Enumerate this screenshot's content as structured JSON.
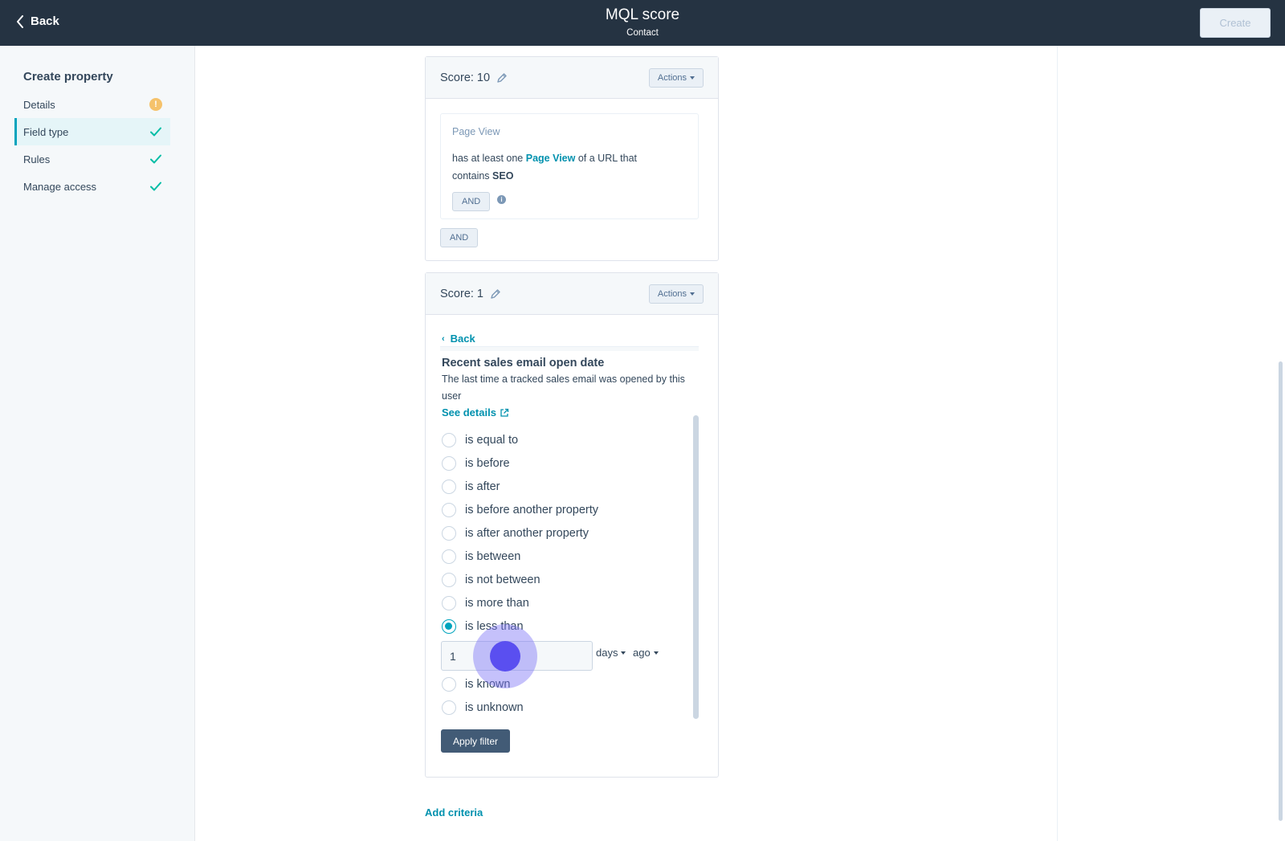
{
  "header": {
    "back_label": "Back",
    "title": "MQL score",
    "subtitle": "Contact",
    "create_label": "Create"
  },
  "sidebar": {
    "title": "Create property",
    "items": [
      {
        "label": "Details",
        "status": "warning"
      },
      {
        "label": "Field type",
        "status": "complete",
        "active": true
      },
      {
        "label": "Rules",
        "status": "complete"
      },
      {
        "label": "Manage access",
        "status": "complete"
      }
    ],
    "warning_glyph": "!"
  },
  "score_cards": [
    {
      "score_label": "Score: 10",
      "actions_label": "Actions",
      "filter": {
        "title": "Page View",
        "desc_prefix": "has at least one",
        "desc_link": "Page View",
        "desc_middle": "of a URL that contains",
        "desc_value": "SEO",
        "and_inner": "AND",
        "info_glyph": "i"
      },
      "and_outer": "AND"
    },
    {
      "score_label": "Score: 1",
      "actions_label": "Actions",
      "back_label": "Back",
      "property_title": "Recent sales email open date",
      "property_desc": "The last time a tracked sales email was opened by this user",
      "see_details": "See details",
      "options": [
        {
          "label": "is equal to",
          "checked": false
        },
        {
          "label": "is before",
          "checked": false
        },
        {
          "label": "is after",
          "checked": false
        },
        {
          "label": "is before another property",
          "checked": false
        },
        {
          "label": "is after another property",
          "checked": false
        },
        {
          "label": "is between",
          "checked": false
        },
        {
          "label": "is not between",
          "checked": false
        },
        {
          "label": "is more than",
          "checked": false
        },
        {
          "label": "is less than",
          "checked": true
        },
        {
          "label": "is known",
          "checked": false
        },
        {
          "label": "is unknown",
          "checked": false
        }
      ],
      "value_input": "1",
      "unit_label": "days",
      "direction_label": "ago",
      "apply_label": "Apply filter"
    }
  ],
  "add_criteria_label": "Add criteria",
  "colors": {
    "header_bg": "#253342",
    "accent": "#00a4bd",
    "link": "#0091ae",
    "warning": "#f5c26b",
    "cursor": "#5a4ff0"
  }
}
